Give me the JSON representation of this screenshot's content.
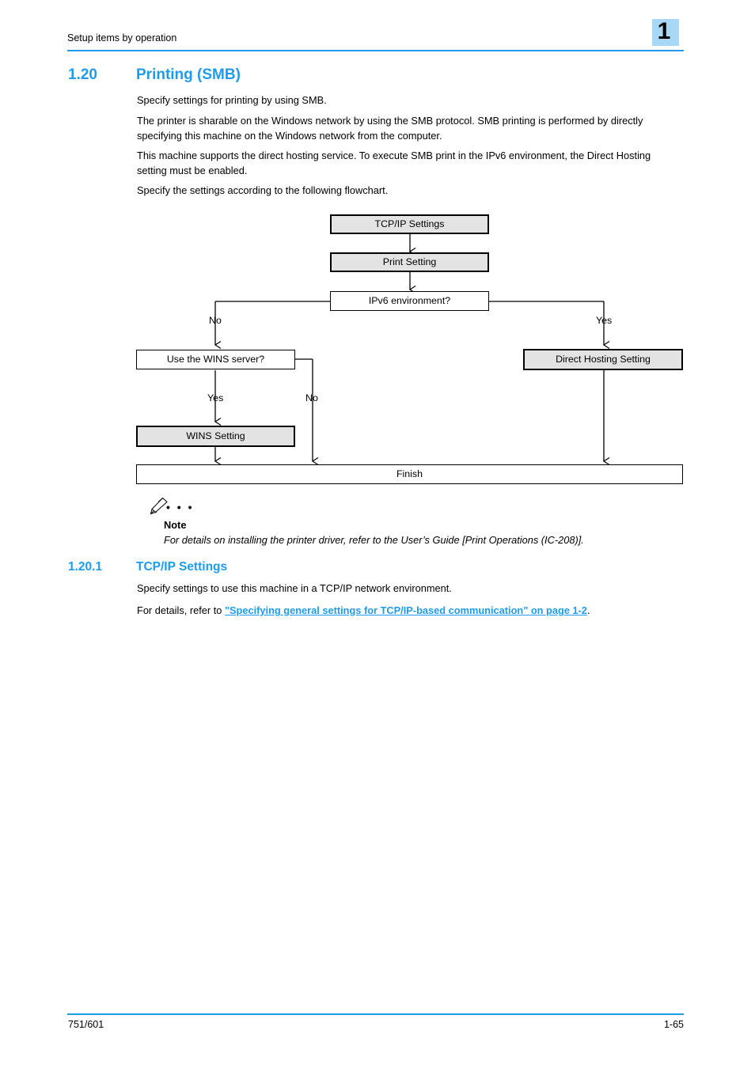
{
  "header": {
    "title": "Setup items by operation",
    "chapter_number": "1",
    "badge_color": "#a8d8f5",
    "rule_color": "#1e9ceb"
  },
  "section": {
    "number": "1.20",
    "title": "Printing (SMB)",
    "accent_color": "#1e9ceb"
  },
  "paragraphs": {
    "p1": "Specify settings for printing by using SMB.",
    "p2": "The printer is sharable on the Windows network by using the SMB protocol. SMB printing is performed by directly specifying this machine on the Windows network from the computer.",
    "p3": "This machine supports the direct hosting service. To execute SMB print in the IPv6 environment, the Direct Hosting setting must be enabled.",
    "p4": "Specify the settings according to the following flowchart."
  },
  "flowchart": {
    "nodes": [
      {
        "id": "tcpip",
        "label": "TCP/IP Settings",
        "style": "shaded"
      },
      {
        "id": "print",
        "label": "Print Setting",
        "style": "shaded"
      },
      {
        "id": "ipv6",
        "label": "IPv6 environment?",
        "style": "plain"
      },
      {
        "id": "wins_q",
        "label": "Use the WINS server?",
        "style": "plain"
      },
      {
        "id": "direct_host",
        "label": "Direct Hosting Setting",
        "style": "shaded"
      },
      {
        "id": "wins_set",
        "label": "WINS Setting",
        "style": "shaded"
      },
      {
        "id": "finish",
        "label": "Finish",
        "style": "plain"
      }
    ],
    "branch_labels": {
      "ipv6_no": "No",
      "ipv6_yes": "Yes",
      "wins_yes": "Yes",
      "wins_no": "No"
    }
  },
  "note": {
    "icon": "pencil-icon",
    "dots": "• • •",
    "title": "Note",
    "body": "For details on installing the printer driver, refer to the User’s Guide [Print Operations (IC-208)]."
  },
  "subsection": {
    "number": "1.20.1",
    "title": "TCP/IP Settings",
    "p1": "Specify settings to use this machine in a TCP/IP network environment.",
    "p2_prefix": "For details, refer to ",
    "p2_link": "\"Specifying general settings for TCP/IP-based communication\" on page 1-2",
    "p2_suffix": "."
  },
  "footer": {
    "left": "751/601",
    "right": "1-65",
    "rule_color": "#1e9ceb"
  }
}
